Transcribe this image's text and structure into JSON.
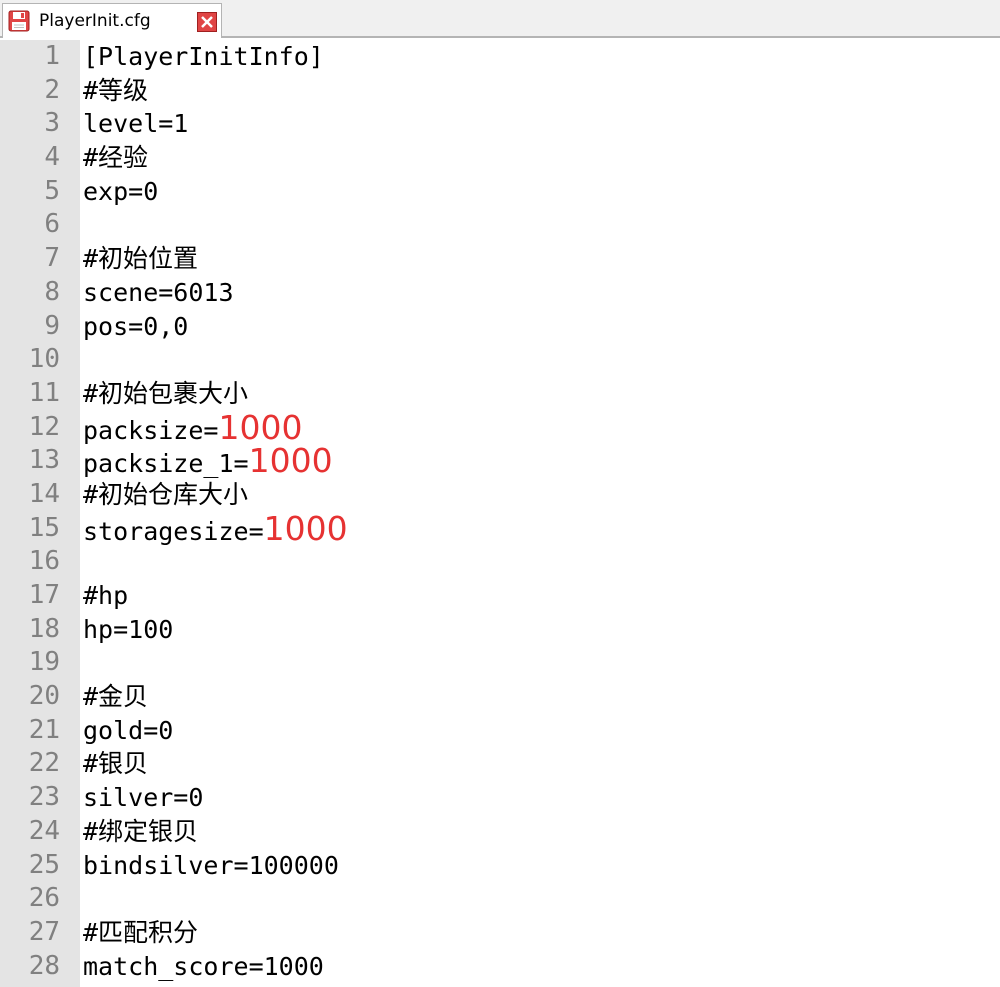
{
  "tab": {
    "title": "PlayerInit.cfg",
    "icon": "save-icon",
    "close_icon": "close-icon",
    "icon_color": "#e04545"
  },
  "editor": {
    "highlight_color": "#e63232",
    "lines": [
      {
        "num": "1",
        "text": "[PlayerInitInfo]",
        "value": ""
      },
      {
        "num": "2",
        "text": "#等级",
        "value": ""
      },
      {
        "num": "3",
        "text": "level=1",
        "value": ""
      },
      {
        "num": "4",
        "text": "#经验",
        "value": ""
      },
      {
        "num": "5",
        "text": "exp=0",
        "value": ""
      },
      {
        "num": "6",
        "text": "",
        "value": ""
      },
      {
        "num": "7",
        "text": "#初始位置",
        "value": ""
      },
      {
        "num": "8",
        "text": "scene=6013",
        "value": ""
      },
      {
        "num": "9",
        "text": "pos=0,0",
        "value": ""
      },
      {
        "num": "10",
        "text": "",
        "value": ""
      },
      {
        "num": "11",
        "text": "#初始包裹大小",
        "value": ""
      },
      {
        "num": "12",
        "text": "packsize=",
        "value": "1000"
      },
      {
        "num": "13",
        "text": "packsize_1=",
        "value": "1000"
      },
      {
        "num": "14",
        "text": "#初始仓库大小",
        "value": ""
      },
      {
        "num": "15",
        "text": "storagesize=",
        "value": "1000"
      },
      {
        "num": "16",
        "text": "",
        "value": ""
      },
      {
        "num": "17",
        "text": "#hp",
        "value": ""
      },
      {
        "num": "18",
        "text": "hp=100",
        "value": ""
      },
      {
        "num": "19",
        "text": "",
        "value": ""
      },
      {
        "num": "20",
        "text": "#金贝",
        "value": ""
      },
      {
        "num": "21",
        "text": "gold=0",
        "value": ""
      },
      {
        "num": "22",
        "text": "#银贝",
        "value": ""
      },
      {
        "num": "23",
        "text": "silver=0",
        "value": ""
      },
      {
        "num": "24",
        "text": "#绑定银贝",
        "value": ""
      },
      {
        "num": "25",
        "text": "bindsilver=100000",
        "value": ""
      },
      {
        "num": "26",
        "text": "",
        "value": ""
      },
      {
        "num": "27",
        "text": "#匹配积分",
        "value": ""
      },
      {
        "num": "28",
        "text": "match_score=1000",
        "value": ""
      }
    ]
  }
}
